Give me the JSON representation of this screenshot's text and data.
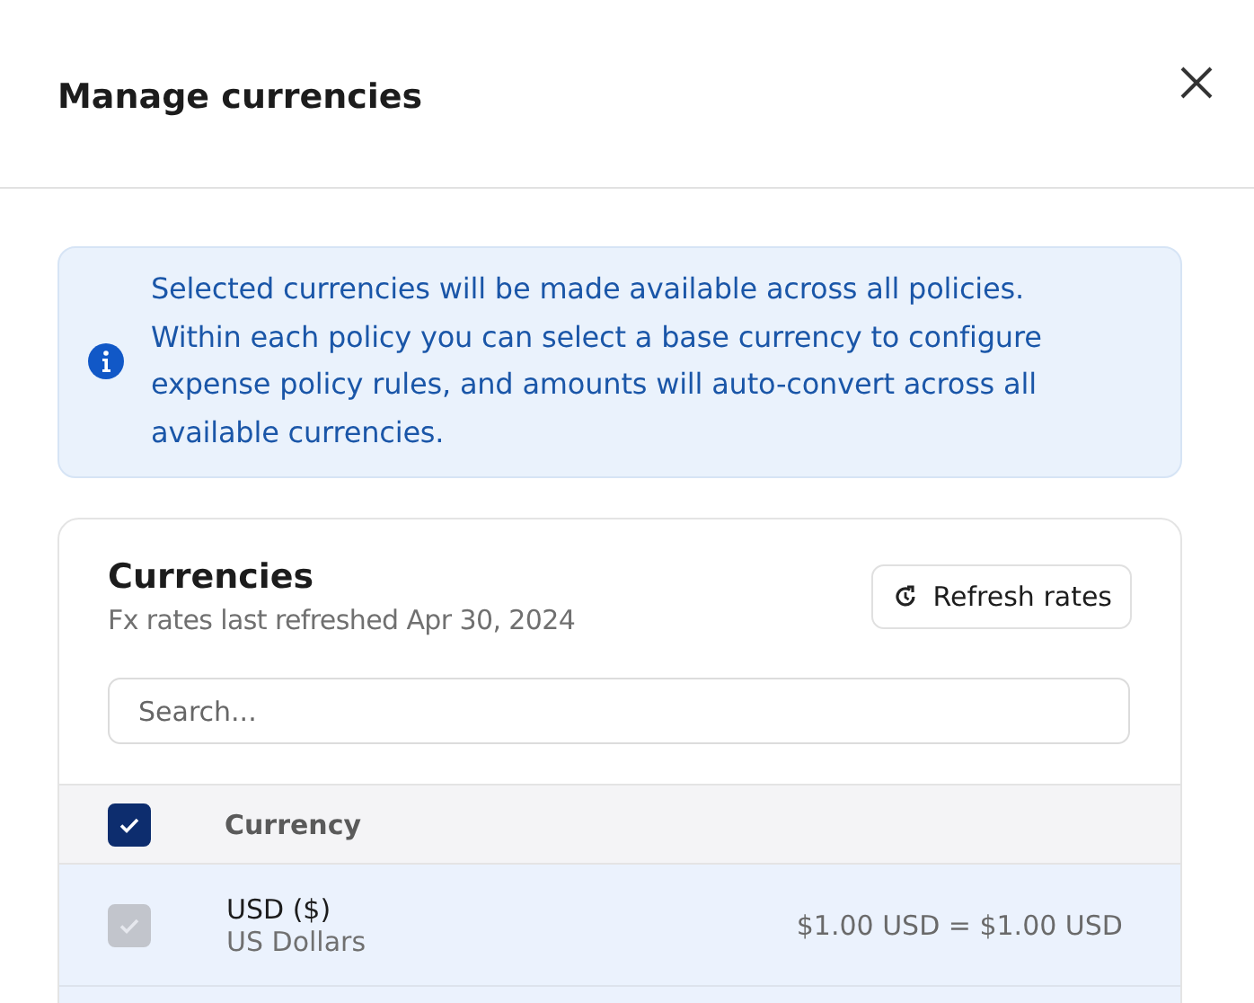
{
  "dialog": {
    "title": "Manage currencies"
  },
  "info": {
    "text": "Selected currencies will be made available across all policies. Within each policy you can select a base currency to configure expense policy rules, and amounts will auto-convert across all available currencies."
  },
  "card": {
    "title": "Currencies",
    "subtitle": "Fx rates last refreshed Apr 30, 2024",
    "refresh_button": "Refresh rates",
    "search": {
      "placeholder": "Search..."
    },
    "table": {
      "header": {
        "checked": true,
        "label": "Currency"
      },
      "rows": [
        {
          "code": "USD ($)",
          "name": "US Dollars",
          "rate": "$1.00 USD = $1.00 USD",
          "checked": true,
          "disabled": true
        }
      ]
    }
  }
}
